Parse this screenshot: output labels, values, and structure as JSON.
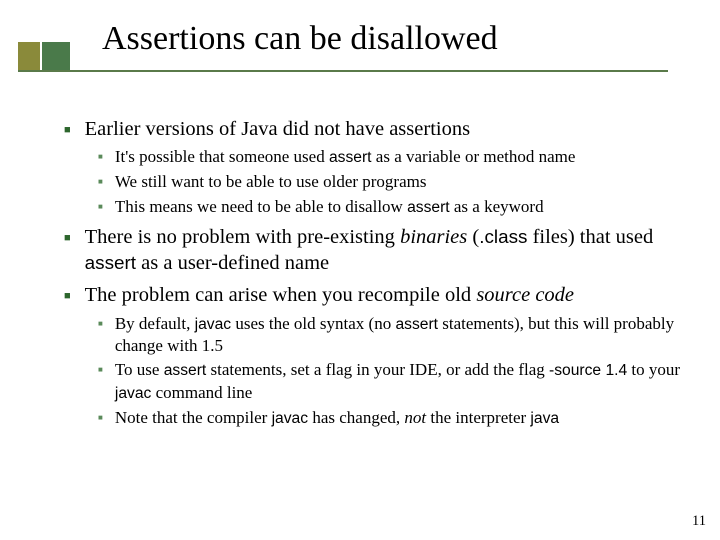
{
  "title": "Assertions can be disallowed",
  "p1": {
    "text": "Earlier versions of Java did not have assertions"
  },
  "p1s": {
    "a": {
      "t1": "It's possible that someone used ",
      "code": "assert",
      "t2": " as a variable or method name"
    },
    "b": "We still want to be able to use older programs",
    "c": {
      "t1": "This means we need to be able to disallow ",
      "code": "assert",
      "t2": " as a keyword"
    }
  },
  "p2": {
    "t1": "There is no problem with pre-existing ",
    "it": "binaries",
    "t2": " (",
    "code": ".class",
    "t3": " files) that used ",
    "code2": "assert",
    "t4": " as a user-defined name"
  },
  "p3": {
    "t1": "The problem can arise when you recompile old ",
    "it": "source code"
  },
  "p3s": {
    "a": {
      "t1": "By default, ",
      "code": "javac",
      "t2": " uses the old syntax (no ",
      "code2": "assert",
      "t3": " statements), but this will probably change with 1.5"
    },
    "b": {
      "t1": "To use ",
      "code": "assert",
      "t2": " statements, set a flag in your IDE, or add the flag ",
      "code2": "-source 1.4",
      "t3": " to your ",
      "code3": "javac",
      "t4": " command line"
    },
    "c": {
      "t1": "Note that the compiler ",
      "code": "javac",
      "t2": " has changed, ",
      "it": "not",
      "t3": " the interpreter ",
      "code2": "java"
    }
  },
  "pagenum": "11"
}
